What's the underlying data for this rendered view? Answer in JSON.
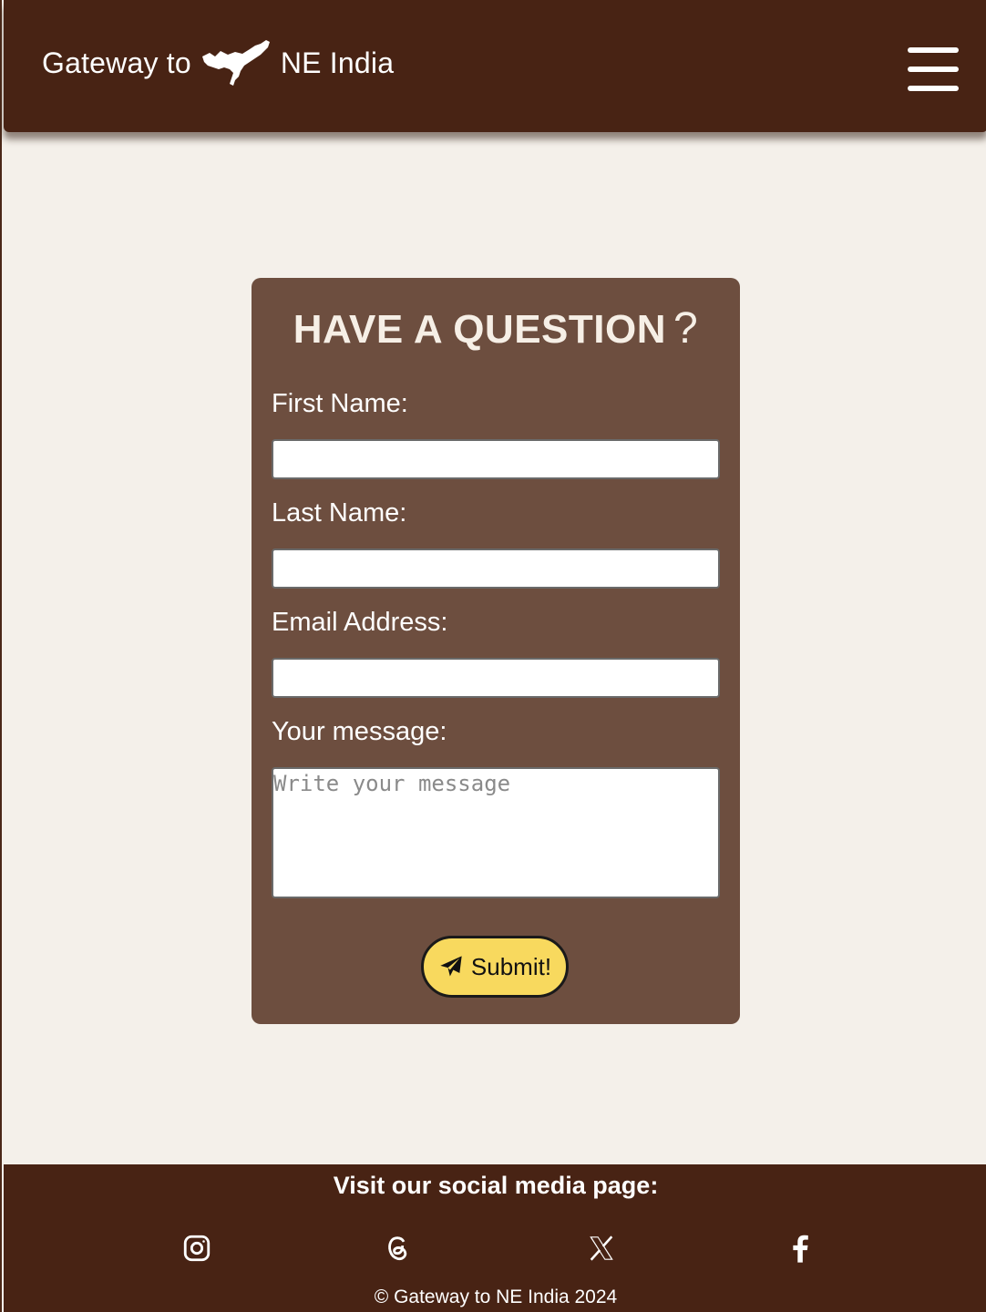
{
  "header": {
    "brand_prefix": "Gateway to",
    "brand_suffix": "NE India",
    "menu_icon": "hamburger-menu-icon"
  },
  "form": {
    "title": "HAVE A QUESTION",
    "title_icon": "question-mark-icon",
    "first_name_label": "First Name:",
    "first_name_value": "",
    "last_name_label": "Last Name:",
    "last_name_value": "",
    "email_label": "Email Address:",
    "email_value": "",
    "message_label": "Your message:",
    "message_placeholder": "Write your message",
    "submit_label": "Submit!",
    "submit_icon": "paper-plane-icon"
  },
  "footer": {
    "visit_text": "Visit our social media page:",
    "social": [
      "instagram-icon",
      "threads-icon",
      "x-icon",
      "facebook-icon"
    ],
    "copyright": "© Gateway to NE India 2024"
  },
  "colors": {
    "header_bg": "#482314",
    "page_bg": "#f4f0ea",
    "card_bg": "#6d4e3f",
    "button_bg": "#f8d95e"
  }
}
